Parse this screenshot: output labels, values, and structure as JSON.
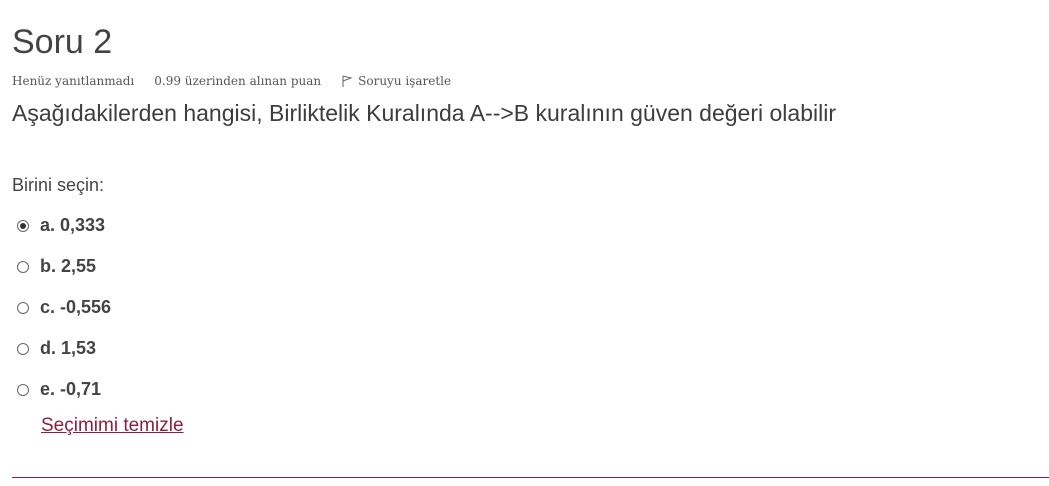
{
  "question": {
    "title": "Soru 2",
    "state": "Henüz yanıtlanmadı",
    "grade": "0.99 üzerinden alınan puan",
    "flag_label": "Soruyu işaretle",
    "text": "Aşağıdakilerden hangisi, Birliktelik Kuralında A-->B kuralının güven değeri olabilir",
    "prompt": "Birini seçin:",
    "answers": [
      {
        "label": "a. 0,333",
        "selected": true
      },
      {
        "label": "b. 2,55",
        "selected": false
      },
      {
        "label": "c. -0,556",
        "selected": false
      },
      {
        "label": "d. 1,53",
        "selected": false
      },
      {
        "label": "e. -0,71",
        "selected": false
      }
    ],
    "clear_label": "Seçimimi temizle"
  },
  "colors": {
    "accent": "#8a2040",
    "text": "#3d3d3d"
  },
  "icons": {
    "flag": "flag-icon"
  }
}
